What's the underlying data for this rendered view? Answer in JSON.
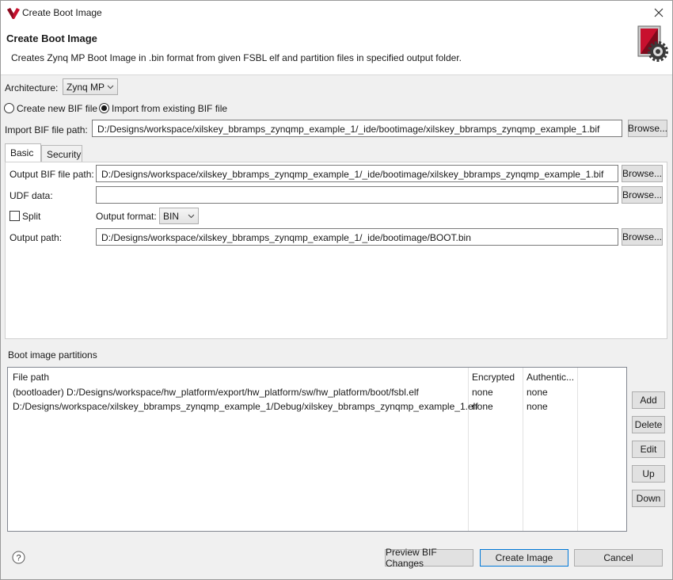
{
  "window": {
    "title": "Create Boot Image",
    "close_label": "×"
  },
  "header": {
    "title": "Create Boot Image",
    "description": "Creates Zynq MP Boot Image in .bin format from given FSBL elf and partition files in specified output folder."
  },
  "architecture": {
    "label": "Architecture:",
    "value": "Zynq MP"
  },
  "bif_mode": {
    "create_new_label": "Create new BIF file",
    "import_label": "Import from existing BIF file",
    "selected": "import"
  },
  "import_bif": {
    "label": "Import BIF file path:",
    "value": "D:/Designs/workspace/xilskey_bbramps_zynqmp_example_1/_ide/bootimage/xilskey_bbramps_zynqmp_example_1.bif",
    "browse_label": "Browse..."
  },
  "tabs": [
    {
      "label": "Basic",
      "active": true
    },
    {
      "label": "Security",
      "active": false
    }
  ],
  "basic": {
    "output_bif": {
      "label": "Output BIF file path:",
      "value": "D:/Designs/workspace/xilskey_bbramps_zynqmp_example_1/_ide/bootimage/xilskey_bbramps_zynqmp_example_1.bif",
      "browse_label": "Browse..."
    },
    "udf": {
      "label": "UDF data:",
      "value": "",
      "browse_label": "Browse..."
    },
    "split": {
      "label": "Split",
      "checked": false
    },
    "output_format": {
      "label": "Output format:",
      "value": "BIN"
    },
    "output_path": {
      "label": "Output path:",
      "value": "D:/Designs/workspace/xilskey_bbramps_zynqmp_example_1/_ide/bootimage/BOOT.bin",
      "browse_label": "Browse..."
    }
  },
  "partitions": {
    "label": "Boot image partitions",
    "columns": [
      "File path",
      "Encrypted",
      "Authentic..."
    ],
    "rows": [
      {
        "file_path": "(bootloader) D:/Designs/workspace/hw_platform/export/hw_platform/sw/hw_platform/boot/fsbl.elf",
        "encrypted": "none",
        "authentication": "none"
      },
      {
        "file_path": "D:/Designs/workspace/xilskey_bbramps_zynqmp_example_1/Debug/xilskey_bbramps_zynqmp_example_1.elf",
        "encrypted": "none",
        "authentication": "none"
      }
    ],
    "buttons": {
      "add": "Add",
      "delete": "Delete",
      "edit": "Edit",
      "up": "Up",
      "down": "Down"
    }
  },
  "footer": {
    "help_glyph": "?",
    "preview_label": "Preview BIF Changes",
    "create_label": "Create Image",
    "cancel_label": "Cancel"
  },
  "colors": {
    "accent": "#0078d7",
    "logo_red": "#c8102e"
  },
  "icons": [
    "xilinx-logo-icon",
    "close-icon",
    "boot-image-gear-icon",
    "chevron-down-icon",
    "help-icon"
  ]
}
